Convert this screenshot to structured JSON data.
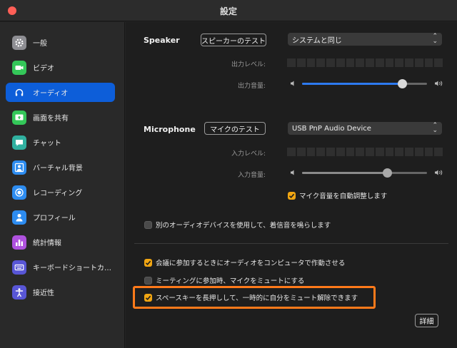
{
  "window": {
    "title": "設定"
  },
  "sidebar": {
    "items": [
      {
        "label": "一般",
        "icon": "gear-icon",
        "color": "#8e8e93",
        "active": false
      },
      {
        "label": "ビデオ",
        "icon": "video-camera-icon",
        "color": "#34c759",
        "active": false
      },
      {
        "label": "オーディオ",
        "icon": "headphones-icon",
        "color": "#0d5ed9",
        "active": true
      },
      {
        "label": "画面を共有",
        "icon": "screen-share-icon",
        "color": "#34c759",
        "active": false
      },
      {
        "label": "チャット",
        "icon": "chat-bubble-icon",
        "color": "#30b0a0",
        "active": false
      },
      {
        "label": "バーチャル背景",
        "icon": "person-background-icon",
        "color": "#2d8cf0",
        "active": false
      },
      {
        "label": "レコーディング",
        "icon": "record-icon",
        "color": "#2d8cf0",
        "active": false
      },
      {
        "label": "プロフィール",
        "icon": "person-icon",
        "color": "#2d8cf0",
        "active": false
      },
      {
        "label": "統計情報",
        "icon": "bar-chart-icon",
        "color": "#af52de",
        "active": false
      },
      {
        "label": "キーボードショートカ…",
        "icon": "keyboard-icon",
        "color": "#5856d6",
        "active": false
      },
      {
        "label": "接近性",
        "icon": "accessibility-icon",
        "color": "#5856d6",
        "active": false
      }
    ]
  },
  "speaker": {
    "label": "Speaker",
    "test_button": "スピーカーのテスト",
    "device": "システムと同じ",
    "level_label": "出力レベル:",
    "volume_label": "出力音量:",
    "volume": 0.8
  },
  "microphone": {
    "label": "Microphone",
    "test_button": "マイクのテスト",
    "device": "USB PnP Audio Device",
    "level_label": "入力レベル:",
    "volume_label": "入力音量:",
    "volume": 0.68,
    "auto_adjust_label": "マイク音量を自動調整します",
    "auto_adjust": true
  },
  "options": {
    "separate_ringtone": {
      "label": "別のオーディオデバイスを使用して、着信音を鳴らします",
      "checked": false
    },
    "join_computer_audio": {
      "label": "会議に参加するときにオーディオをコンピュータで作動させる",
      "checked": true
    },
    "mute_on_join": {
      "label": "ミーティングに参加時、マイクをミュートにする",
      "checked": false
    },
    "space_unmute": {
      "label": "スペースキーを長押しして、一時的に自分をミュート解除できます",
      "checked": true
    }
  },
  "details_button": "詳細",
  "colors": {
    "accent": "#0d5ed9",
    "checkbox": "#f1a612",
    "highlight": "#ff7a1a"
  }
}
